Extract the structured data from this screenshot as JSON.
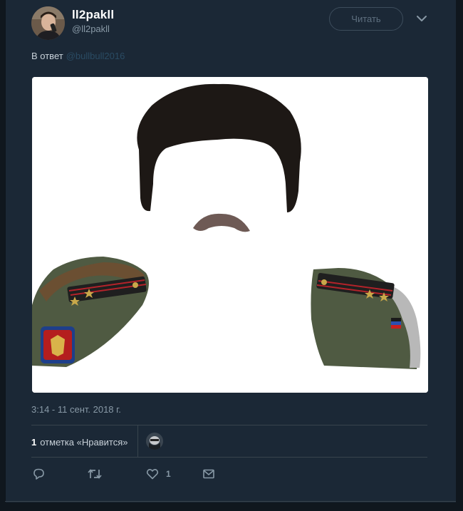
{
  "tweet": {
    "author": {
      "display_name": "ll2pakll",
      "handle": "@ll2pakll"
    },
    "follow_label": "Читать",
    "reply_prefix": "В ответ",
    "reply_mention": "@bullbull2016",
    "timestamp": "3:14 - 11 сент. 2018 г.",
    "likes": {
      "count": "1",
      "label": "отметка «Нравится»"
    },
    "actions": {
      "reply_icon": "reply-icon",
      "retweet_icon": "retweet-icon",
      "like_icon": "heart-icon",
      "like_count": "1",
      "dm_icon": "envelope-icon"
    }
  },
  "colors": {
    "background": "#10171e",
    "card": "#1b2836",
    "muted_text": "#8899a6",
    "divider": "#38444d"
  }
}
